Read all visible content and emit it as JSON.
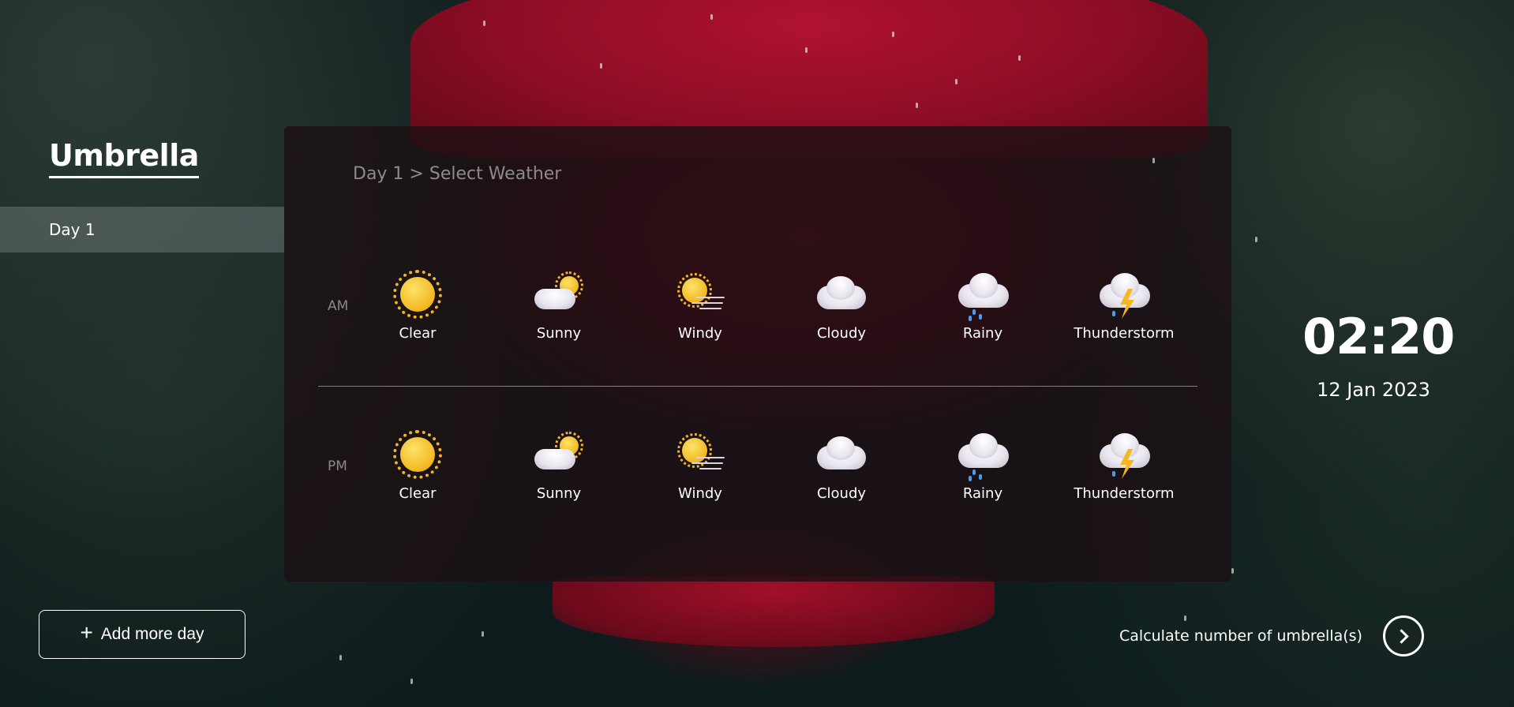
{
  "sidebar": {
    "brand": "Umbrella",
    "days": [
      {
        "label": "Day 1"
      }
    ],
    "add_day_label": "Add more day"
  },
  "panel": {
    "breadcrumb": "Day 1 > Select Weather",
    "rows": [
      {
        "label": "AM",
        "options": [
          {
            "label": "Clear",
            "icon": "sun-icon"
          },
          {
            "label": "Sunny",
            "icon": "partly-sunny-icon"
          },
          {
            "label": "Windy",
            "icon": "windy-sun-icon"
          },
          {
            "label": "Cloudy",
            "icon": "cloud-icon"
          },
          {
            "label": "Rainy",
            "icon": "rain-cloud-icon"
          },
          {
            "label": "Thunderstorm",
            "icon": "thunderstorm-icon"
          }
        ]
      },
      {
        "label": "PM",
        "options": [
          {
            "label": "Clear",
            "icon": "sun-icon"
          },
          {
            "label": "Sunny",
            "icon": "partly-sunny-icon"
          },
          {
            "label": "Windy",
            "icon": "windy-sun-icon"
          },
          {
            "label": "Cloudy",
            "icon": "cloud-icon"
          },
          {
            "label": "Rainy",
            "icon": "rain-cloud-icon"
          },
          {
            "label": "Thunderstorm",
            "icon": "thunderstorm-icon"
          }
        ]
      }
    ]
  },
  "clock": {
    "time": "02:20",
    "date": "12 Jan 2023"
  },
  "footer": {
    "calculate_label": "Calculate number of umbrella(s)"
  },
  "colors": {
    "accent_red": "#8c0d24",
    "background": "#0d1b1d",
    "sun": "#f2b71f",
    "rain": "#4a9bf0"
  }
}
